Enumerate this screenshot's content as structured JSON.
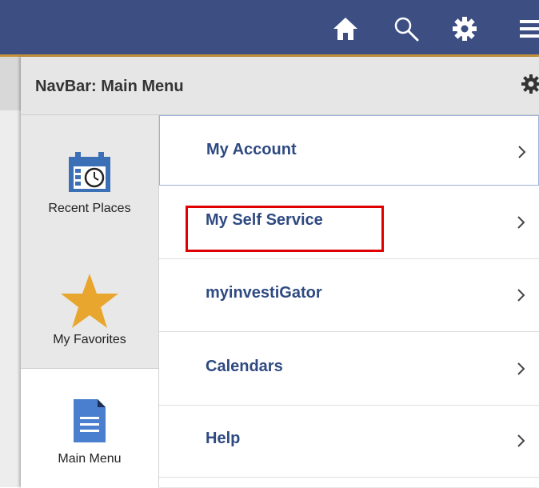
{
  "header": {
    "icons": [
      "home-icon",
      "search-icon",
      "gear-icon",
      "hamburger-menu-icon"
    ],
    "accent_color": "#3d4e82"
  },
  "panel": {
    "title": "NavBar: Main Menu"
  },
  "tiles": [
    {
      "label": "Recent Places",
      "icon": "calendar-clock-icon"
    },
    {
      "label": "My Favorites",
      "icon": "star-icon"
    },
    {
      "label": "Main Menu",
      "icon": "document-icon"
    }
  ],
  "menu": {
    "items": [
      {
        "label": "My Account"
      },
      {
        "label": "My Self Service"
      },
      {
        "label": "myinvestiGator"
      },
      {
        "label": "Calendars"
      },
      {
        "label": "Help"
      }
    ]
  },
  "highlight_color": "#e00000"
}
